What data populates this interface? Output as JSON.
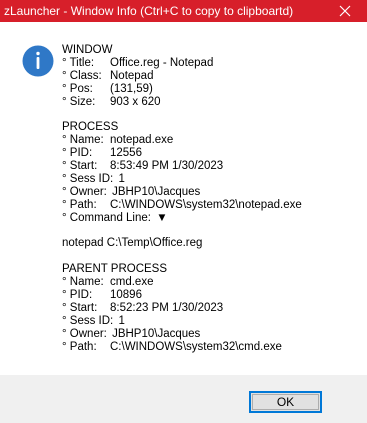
{
  "window": {
    "title": "zLauncher - Window Info (Ctrl+C to copy to clipboartd)"
  },
  "icons": {
    "info": "info-icon",
    "close": "close-icon"
  },
  "colors": {
    "titlebar": "#d71f2a",
    "info_icon": "#2f78c7",
    "footer": "#f0f0f0",
    "ok_border": "#0078d7",
    "ok_bg": "#e1e1e1"
  },
  "sections": {
    "window": {
      "heading": "WINDOW",
      "rows": [
        {
          "label": "° Title:",
          "value": "Office.reg - Notepad"
        },
        {
          "label": "° Class:",
          "value": "Notepad"
        },
        {
          "label": "° Pos:",
          "value": "(131,59)"
        },
        {
          "label": "° Size:",
          "value": "903 x 620"
        }
      ]
    },
    "process": {
      "heading": "PROCESS",
      "rows": [
        {
          "label": "° Name:",
          "value": "notepad.exe"
        },
        {
          "label": "° PID:",
          "value": "12556"
        },
        {
          "label": "° Start:",
          "value": "8:53:49 PM 1/30/2023"
        },
        {
          "label": "° Sess ID:",
          "value": "1"
        },
        {
          "label": "° Owner:",
          "value": "JBHP10\\Jacques"
        },
        {
          "label": "° Path:",
          "value": "C:\\WINDOWS\\system32\\notepad.exe"
        }
      ],
      "command_line_label": "° Command Line:",
      "command_line_symbol": "▼",
      "command_line_value": "notepad  C:\\Temp\\Office.reg"
    },
    "parent_process": {
      "heading": "PARENT PROCESS",
      "rows": [
        {
          "label": "° Name:",
          "value": "cmd.exe"
        },
        {
          "label": "° PID:",
          "value": "10896"
        },
        {
          "label": "° Start:",
          "value": "8:52:23 PM 1/30/2023"
        },
        {
          "label": "° Sess ID:",
          "value": "1"
        },
        {
          "label": "° Owner:",
          "value": "JBHP10\\Jacques"
        },
        {
          "label": "° Path:",
          "value": "C:\\WINDOWS\\system32\\cmd.exe"
        }
      ]
    }
  },
  "buttons": {
    "ok": "OK"
  }
}
